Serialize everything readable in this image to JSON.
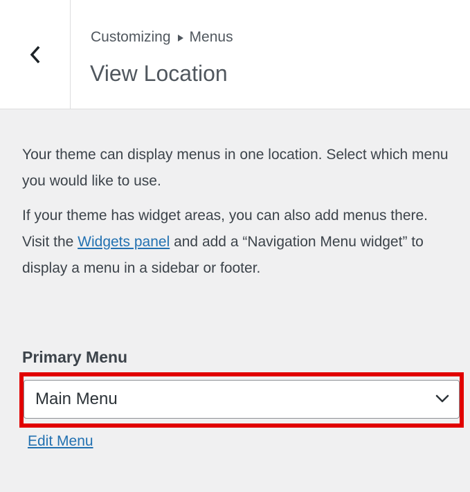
{
  "header": {
    "breadcrumb_root": "Customizing",
    "breadcrumb_section": "Menus",
    "title": "View Location"
  },
  "description": {
    "paragraph1": "Your theme can display menus in one location. Select which menu you would like to use.",
    "paragraph2_before": "If your theme has widget areas, you can also add menus there. Visit the ",
    "paragraph2_link": "Widgets panel",
    "paragraph2_after": " and add a “Navigation Menu widget” to display a menu in a sidebar or footer."
  },
  "location": {
    "label": "Primary Menu",
    "selected": "Main Menu",
    "edit_link": "Edit Menu"
  },
  "icons": {
    "back": "chevron-left-icon",
    "dropdown": "chevron-down-icon",
    "separator": "triangle-right-icon"
  },
  "colors": {
    "highlight": "#e10000",
    "link": "#2271b1",
    "panel_bg": "#f0f0f1"
  }
}
